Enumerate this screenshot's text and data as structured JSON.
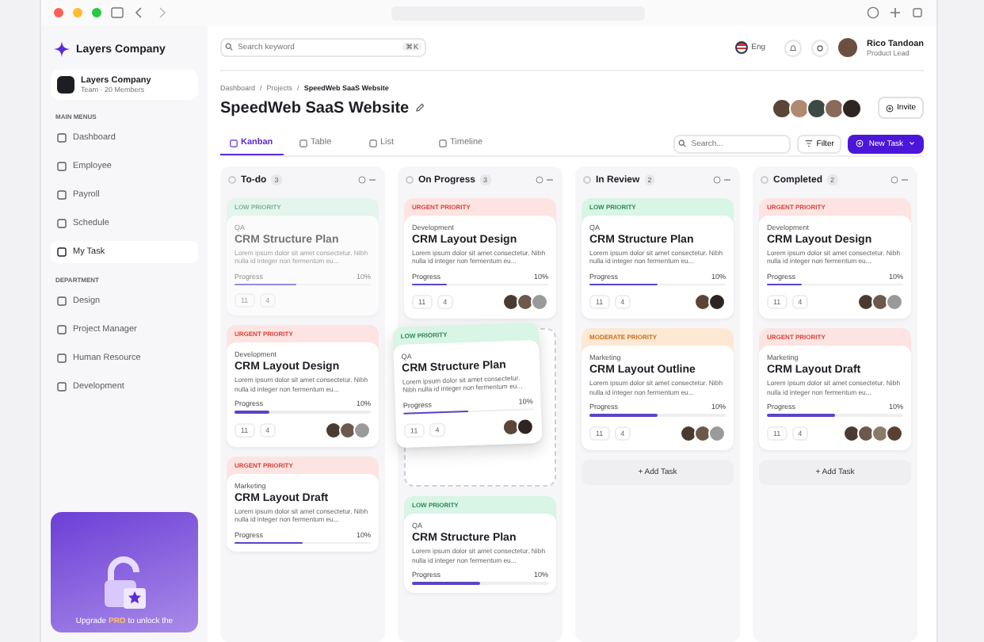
{
  "sidebar": {
    "brand": "Layers Company",
    "team": {
      "name": "Layers Company",
      "members": "Team · 20 Members"
    },
    "sections": [
      {
        "heading": "MAIN MENUS",
        "items": [
          {
            "label": "Dashboard",
            "selected": false
          },
          {
            "label": "Employee",
            "selected": false
          },
          {
            "label": "Payroll",
            "selected": false
          },
          {
            "label": "Schedule",
            "selected": false
          },
          {
            "label": "My Task",
            "selected": true
          }
        ]
      },
      {
        "heading": "DEPARTMENT",
        "items": [
          {
            "label": "Design",
            "selected": false
          },
          {
            "label": "Project Manager",
            "selected": false
          },
          {
            "label": "Human Resource",
            "selected": false
          },
          {
            "label": "Development",
            "selected": false
          }
        ]
      }
    ],
    "upgrade": "Upgrade **PRO** to unlock the"
  },
  "header": {
    "search": {
      "placeholder": "Search keyword",
      "shortcut": "⌘K"
    },
    "language": "Eng",
    "user": {
      "name": "Rico Tandoan",
      "role": "Product Lead"
    }
  },
  "breadcrumb": [
    "Dashboard",
    "Projects",
    "SpeedWeb SaaS Website"
  ],
  "breadcrumb_separator": "/",
  "title": "SpeedWeb SaaS Website",
  "team_avatars": [
    {
      "color": "#5a4536"
    },
    {
      "color": "#b08a70"
    },
    {
      "color": "#3d4a44"
    },
    {
      "color": "#8a6a5a"
    },
    {
      "color": "#2e2522"
    }
  ],
  "invite": "Invite",
  "tabs": [
    {
      "label": "Kanban",
      "selected": true
    },
    {
      "label": "Table",
      "selected": false
    },
    {
      "label": "List",
      "selected": false
    },
    {
      "label": "Timeline",
      "selected": false
    }
  ],
  "toolbar": {
    "search": {
      "placeholder": "Search..."
    },
    "filter": "Filter",
    "new_task": "New Task"
  },
  "columns": [
    {
      "name": "To-do",
      "count": "3",
      "items": [
        {
          "kind": "low",
          "faded": true,
          "priority_label": "LOW PRIORITY",
          "category": "QA",
          "title": "CRM Structure Plan",
          "description": "Lorem ipsum dolor sit amet consectetur. Nibh nulla id integer non fermentum eu...",
          "progress_label": "Progress",
          "percent": "10%",
          "level": 0.45,
          "comments": "11",
          "attachments": "4"
        },
        {
          "kind": "urgent",
          "faded": false,
          "priority_label": "URGENT PRIORITY",
          "category": "Development",
          "title": "CRM Layout Design",
          "description": "Lorem ipsum dolor sit amet consectetur. Nibh nulla id integer non fermentum eu...",
          "progress_label": "Progress",
          "percent": "10%",
          "level": 0.25,
          "comments": "11",
          "attachments": "4",
          "avatars": [
            {
              "color": "#4a3a30"
            },
            {
              "color": "#6d584c"
            },
            {
              "color": "#9a9a9a"
            }
          ]
        },
        {
          "kind": "urgent",
          "faded": false,
          "priority_label": "URGENT PRIORITY",
          "category": "Marketing",
          "title": "CRM Layout Draft",
          "description": "Lorem ipsum dolor sit amet consectetur. Nibh nulla id integer non fermentum eu...",
          "progress_label": "Progress",
          "percent": "10%",
          "level": 0.5
        }
      ]
    },
    {
      "name": "On Progress",
      "count": "3",
      "items": [
        {
          "kind": "urgent",
          "faded": false,
          "priority_label": "URGENT PRIORITY",
          "category": "Development",
          "title": "CRM Layout Design",
          "description": "Lorem ipsum dolor sit amet consectetur. Nibh nulla id integer non fermentum eu...",
          "progress_label": "Progress",
          "percent": "10%",
          "level": 0.25,
          "comments": "11",
          "attachments": "4",
          "avatars": [
            {
              "color": "#4a3a30"
            },
            {
              "color": "#6d584c"
            },
            {
              "color": "#9a9a9a"
            }
          ]
        },
        {
          "kind": "drop-zone"
        },
        {
          "kind": "low",
          "faded": false,
          "priority_label": "LOW PRIORITY",
          "category": "QA",
          "title": "CRM Structure Plan",
          "description": "Lorem ipsum dolor sit amet consectetur. Nibh nulla id integer non fermentum eu...",
          "progress_label": "Progress",
          "percent": "10%",
          "level": 0.5
        }
      ]
    },
    {
      "name": "In Review",
      "count": "2",
      "add_task": "+ Add Task",
      "items": [
        {
          "kind": "low",
          "faded": false,
          "priority_label": "LOW PRIORITY",
          "category": "QA",
          "title": "CRM Structure Plan",
          "description": "Lorem ipsum dolor sit amet consectetur. Nibh nulla id integer non fermentum eu...",
          "progress_label": "Progress",
          "percent": "10%",
          "level": 0.5,
          "comments": "11",
          "attachments": "4",
          "avatars": [
            {
              "color": "#5a4536"
            },
            {
              "color": "#2e2522"
            }
          ]
        },
        {
          "kind": "moderate",
          "faded": false,
          "priority_label": "MODERATE PRIORITY",
          "category": "Marketing",
          "title": "CRM Layout Outline",
          "description": "Lorem ipsum dolor sit amet consectetur. Nibh nulla id integer non fermentum eu...",
          "progress_label": "Progress",
          "percent": "10%",
          "level": 0.5,
          "comments": "11",
          "attachments": "4",
          "avatars": [
            {
              "color": "#4a3a30"
            },
            {
              "color": "#6d584c"
            },
            {
              "color": "#9a9a9a"
            }
          ]
        }
      ]
    },
    {
      "name": "Completed",
      "count": "2",
      "add_task": "+ Add Task",
      "items": [
        {
          "kind": "urgent",
          "faded": false,
          "priority_label": "URGENT PRIORITY",
          "category": "Development",
          "title": "CRM Layout Design",
          "description": "Lorem ipsum dolor sit amet consectetur. Nibh nulla id integer non fermentum eu...",
          "progress_label": "Progress",
          "percent": "10%",
          "level": 0.25,
          "comments": "11",
          "attachments": "4",
          "avatars": [
            {
              "color": "#4a3a30"
            },
            {
              "color": "#6d584c"
            },
            {
              "color": "#9a9a9a"
            }
          ]
        },
        {
          "kind": "urgent",
          "faded": false,
          "priority_label": "URGENT PRIORITY",
          "category": "Marketing",
          "title": "CRM Layout Draft",
          "description": "Lorem ipsum dolor sit amet consectetur. Nibh nulla id integer non fermentum eu...",
          "progress_label": "Progress",
          "percent": "10%",
          "level": 0.5,
          "comments": "11",
          "attachments": "4",
          "avatars": [
            {
              "color": "#4a3a30"
            },
            {
              "color": "#6d584c"
            },
            {
              "color": "#8a7a6a"
            },
            {
              "color": "#5a4030"
            }
          ]
        }
      ]
    }
  ],
  "dragged_card": {
    "kind": "low",
    "faded": false,
    "priority_label": "LOW PRIORITY",
    "category": "QA",
    "title": "CRM Structure Plan",
    "description": "Lorem ipsum dolor sit amet consectetur. Nibh nulla id integer non fermentum eu...",
    "progress_label": "Progress",
    "percent": "10%",
    "level": 0.5,
    "comments": "11",
    "attachments": "4",
    "avatars": [
      {
        "color": "#5a4536"
      },
      {
        "color": "#2e2522"
      }
    ]
  }
}
